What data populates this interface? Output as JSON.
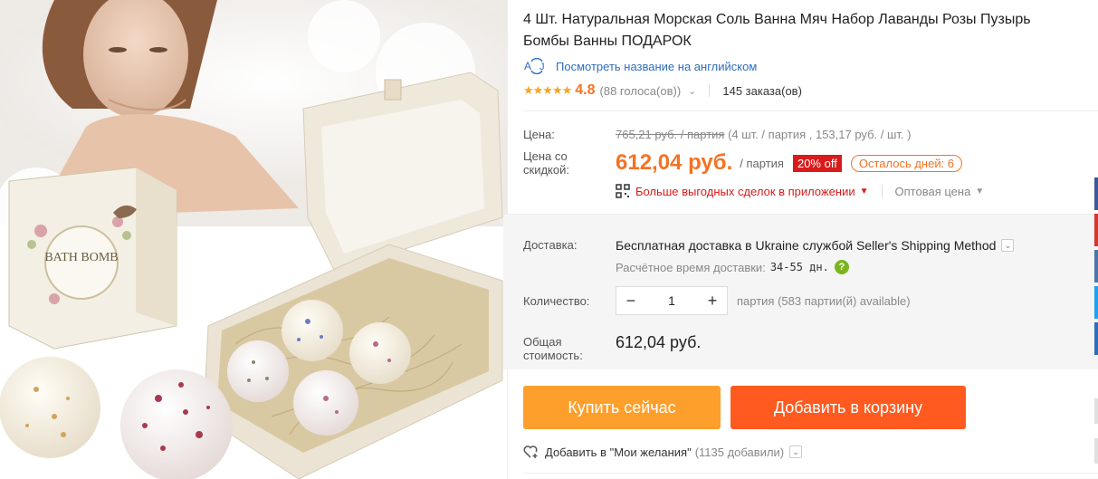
{
  "product": {
    "title": "4 Шт. Натуральная Морская Соль Ванна Мяч Набор Лаванды Розы Пузырь Бомбы Ванны ПОДАРОК",
    "translate_link": "Посмотреть название на английском",
    "rating": {
      "stars": "★★★★★",
      "value": "4.8",
      "votes": "(88 голоса(ов))",
      "orders": "145 заказа(ов)"
    },
    "image_label": "BATH BOMB"
  },
  "price": {
    "label": "Цена:",
    "old": "765,21 руб. / партия",
    "old_detail": "(4 шт. / партия , 153,17 руб. / шт. )",
    "discount_label": "Цена со скидкой:",
    "current": "612,04 руб.",
    "per_lot": "/ партия",
    "discount_badge": "20% off",
    "days_left": "Осталось дней: 6"
  },
  "app_deals": {
    "label": "Больше выгодных сделок в приложении",
    "wholesale": "Оптовая цена"
  },
  "shipping": {
    "label": "Доставка:",
    "text": "Бесплатная доставка в Ukraine службой Seller's Shipping Method",
    "eta_label": "Расчётное время доставки:",
    "eta_days": "34-55 дн."
  },
  "quantity": {
    "label": "Количество:",
    "minus": "−",
    "value": "1",
    "plus": "+",
    "note": "партия (583 партии(й) available)"
  },
  "total": {
    "label": "Общая стоимость:",
    "value": "612,04 руб."
  },
  "actions": {
    "buy_now": "Купить сейчас",
    "add_to_cart": "Добавить в корзину"
  },
  "wishlist": {
    "label": "Добавить в \"Мои желания\"",
    "count": "(1135 добавили)"
  },
  "colors": {
    "accent": "#f57224",
    "buy": "#fe9f2b",
    "cart": "#ff5a1f",
    "sale": "#d91b1b",
    "link": "#2e6dbd"
  }
}
